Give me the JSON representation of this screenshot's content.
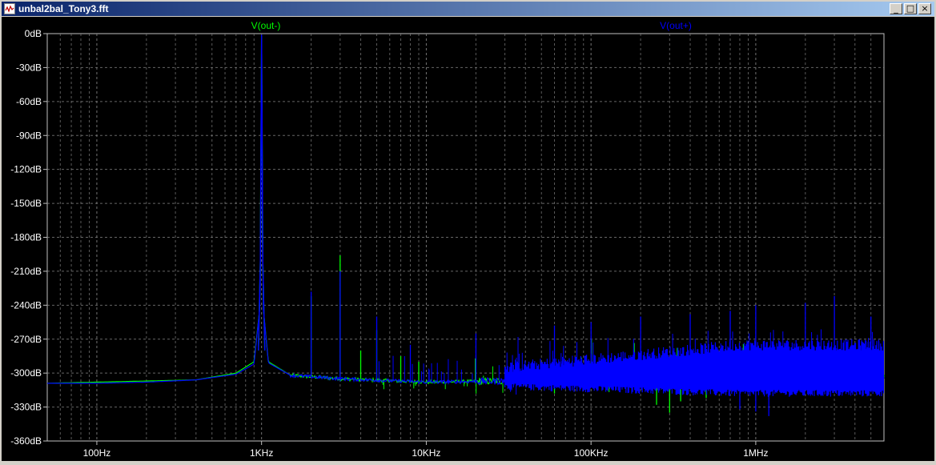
{
  "window": {
    "title": "unbal2bal_Tony3.fft",
    "minimize_label": "_",
    "maximize_label": "□",
    "close_label": "×"
  },
  "colors": {
    "background": "#000000",
    "grid": "#808080",
    "axis": "#c0c0c0",
    "tick_text": "#ffffff",
    "series_out_minus": "#00ff00",
    "series_out_plus": "#0000ff"
  },
  "chart_data": {
    "type": "line",
    "title": "",
    "xlabel": "",
    "ylabel": "",
    "x_scale": "log",
    "xlim": [
      50,
      6000000
    ],
    "ylim": [
      -360,
      0
    ],
    "grid": true,
    "x_ticks": [
      {
        "value": 100,
        "label": "100Hz"
      },
      {
        "value": 1000,
        "label": "1KHz"
      },
      {
        "value": 10000,
        "label": "10KHz"
      },
      {
        "value": 100000,
        "label": "100KHz"
      },
      {
        "value": 1000000,
        "label": "1MHz"
      }
    ],
    "y_ticks": [
      {
        "value": 0,
        "label": "0dB"
      },
      {
        "value": -30,
        "label": "-30dB"
      },
      {
        "value": -60,
        "label": "-60dB"
      },
      {
        "value": -90,
        "label": "-90dB"
      },
      {
        "value": -120,
        "label": "-120dB"
      },
      {
        "value": -150,
        "label": "-150dB"
      },
      {
        "value": -180,
        "label": "-180dB"
      },
      {
        "value": -210,
        "label": "-210dB"
      },
      {
        "value": -240,
        "label": "-240dB"
      },
      {
        "value": -270,
        "label": "-270dB"
      },
      {
        "value": -300,
        "label": "-300dB"
      },
      {
        "value": -330,
        "label": "-330dB"
      },
      {
        "value": -360,
        "label": "-360dB"
      }
    ],
    "series": [
      {
        "name": "V(out-)",
        "color": "#00ff00",
        "baseline": [
          [
            50,
            -309
          ],
          [
            100,
            -308
          ],
          [
            200,
            -307
          ],
          [
            400,
            -306
          ],
          [
            700,
            -300
          ],
          [
            900,
            -290
          ],
          [
            980,
            -240
          ],
          [
            1000,
            -2
          ],
          [
            1020,
            -240
          ],
          [
            1100,
            -290
          ],
          [
            1500,
            -302
          ],
          [
            3000,
            -305
          ],
          [
            10000,
            -308
          ],
          [
            30000,
            -307
          ],
          [
            100000,
            -305
          ],
          [
            300000,
            -303
          ],
          [
            1000000,
            -302
          ],
          [
            3000000,
            -300
          ],
          [
            6000000,
            -304
          ]
        ],
        "spikes": [
          [
            2000,
            -232
          ],
          [
            3000,
            -196
          ],
          [
            4000,
            -280
          ],
          [
            5000,
            -262
          ],
          [
            7000,
            -285
          ],
          [
            9000,
            -290
          ]
        ],
        "dips": [
          [
            60000,
            -318
          ],
          [
            250000,
            -328
          ],
          [
            300000,
            -335
          ],
          [
            350000,
            -325
          ],
          [
            500000,
            -322
          ]
        ]
      },
      {
        "name": "V(out+)",
        "color": "#0000ff",
        "baseline": [
          [
            50,
            -309
          ],
          [
            100,
            -309
          ],
          [
            200,
            -308
          ],
          [
            400,
            -306
          ],
          [
            700,
            -301
          ],
          [
            900,
            -292
          ],
          [
            980,
            -240
          ],
          [
            1000,
            -1
          ],
          [
            1020,
            -240
          ],
          [
            1100,
            -291
          ],
          [
            1500,
            -302
          ],
          [
            3000,
            -305
          ],
          [
            10000,
            -308
          ],
          [
            30000,
            -307
          ],
          [
            100000,
            -305
          ],
          [
            300000,
            -303
          ],
          [
            1000000,
            -302
          ],
          [
            3000000,
            -300
          ],
          [
            6000000,
            -304
          ]
        ],
        "spikes": [
          [
            2000,
            -228
          ],
          [
            3000,
            -210
          ],
          [
            5000,
            -250
          ],
          [
            8000,
            -275
          ],
          [
            20000,
            -265
          ],
          [
            60000,
            -258
          ],
          [
            100000,
            -255
          ],
          [
            200000,
            -250
          ],
          [
            400000,
            -248
          ],
          [
            700000,
            -245
          ],
          [
            1000000,
            -240
          ],
          [
            2000000,
            -238
          ],
          [
            3000000,
            -232
          ],
          [
            5000000,
            -250
          ]
        ],
        "dips": [
          [
            800000,
            -332
          ],
          [
            1000000,
            -334
          ],
          [
            1200000,
            -338
          ]
        ],
        "band": {
          "x_start": 30000,
          "x_end": 6000000,
          "low": -318,
          "high": -275
        }
      }
    ]
  }
}
